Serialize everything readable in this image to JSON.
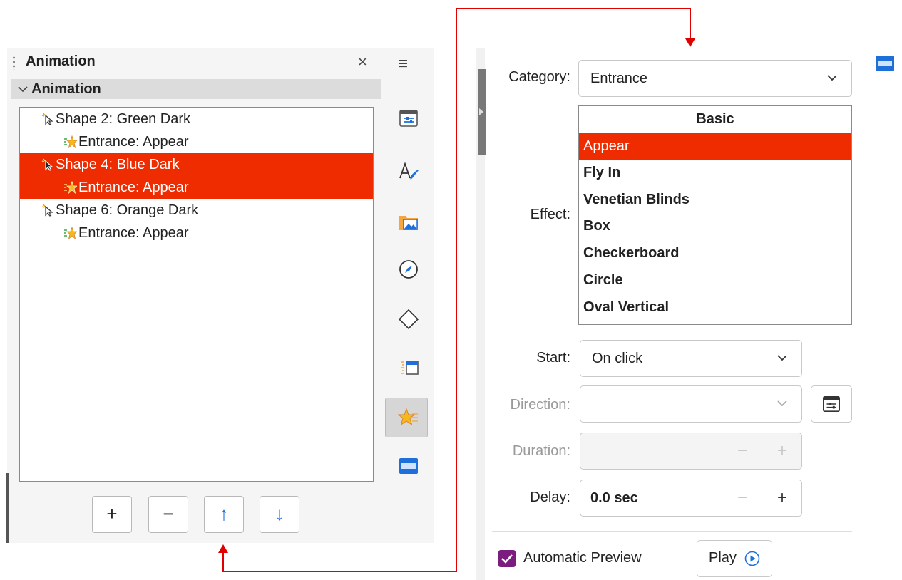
{
  "deck": {
    "title": "Animation",
    "close_glyph": "×",
    "section_label": "Animation"
  },
  "animation_list": [
    {
      "label": "Shape 2: Green Dark",
      "level": 0,
      "selected": false,
      "icon": "cursor-sparkle-icon"
    },
    {
      "label": "Entrance: Appear",
      "level": 1,
      "selected": false,
      "icon": "star-entrance-icon"
    },
    {
      "label": "Shape 4: Blue Dark",
      "level": 0,
      "selected": true,
      "icon": "cursor-sparkle-icon"
    },
    {
      "label": "Entrance: Appear",
      "level": 1,
      "selected": true,
      "icon": "star-entrance-icon"
    },
    {
      "label": "Shape 6: Orange Dark",
      "level": 0,
      "selected": false,
      "icon": "cursor-sparkle-icon"
    },
    {
      "label": "Entrance: Appear",
      "level": 1,
      "selected": false,
      "icon": "star-entrance-icon"
    }
  ],
  "list_buttons": {
    "add": "+",
    "remove": "−",
    "move_up": "↑",
    "move_down": "↓"
  },
  "sidebar": {
    "menu_glyph": "≡",
    "icons": [
      "properties-icon",
      "styles-icon",
      "gallery-icon",
      "navigator-icon",
      "shapes-icon",
      "slide-transition-icon",
      "animation-icon",
      "master-slides-icon"
    ],
    "active": "animation-icon"
  },
  "effect_panel": {
    "category_label": "Category:",
    "category_value": "Entrance",
    "effect_label": "Effect:",
    "effect_group": "Basic",
    "effects": [
      {
        "label": "Appear",
        "selected": true
      },
      {
        "label": "Fly In",
        "selected": false
      },
      {
        "label": "Venetian Blinds",
        "selected": false
      },
      {
        "label": "Box",
        "selected": false
      },
      {
        "label": "Checkerboard",
        "selected": false
      },
      {
        "label": "Circle",
        "selected": false
      },
      {
        "label": "Oval Vertical",
        "selected": false
      }
    ],
    "start_label": "Start:",
    "start_value": "On click",
    "direction_label": "Direction:",
    "direction_value": "",
    "duration_label": "Duration:",
    "duration_value": "",
    "delay_label": "Delay:",
    "delay_value": "0.0 sec",
    "spin_minus": "−",
    "spin_plus": "+",
    "auto_preview_label": "Automatic Preview",
    "auto_preview_checked": true,
    "play_label": "Play"
  },
  "colors": {
    "selection": "#ef2b00",
    "accent_blue": "#1e6fd9",
    "checkbox": "#7b1d7e",
    "annotation": "#e10000"
  }
}
